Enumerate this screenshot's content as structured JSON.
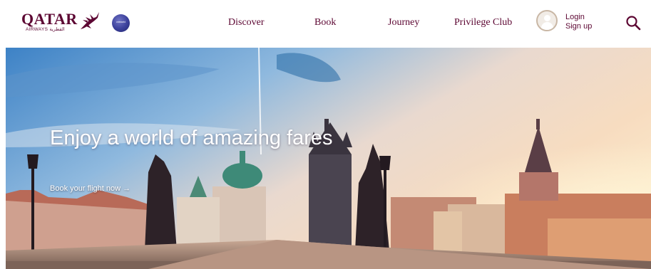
{
  "brand": {
    "name": "QATAR",
    "sub": "AIRWAYS القطرية",
    "alliance": "oneworld"
  },
  "nav": {
    "items": [
      {
        "label": "Discover"
      },
      {
        "label": "Book"
      },
      {
        "label": "Journey"
      },
      {
        "label": "Privilege Club"
      }
    ]
  },
  "account": {
    "login_label": "Login",
    "signup_label": "Sign up"
  },
  "hero": {
    "title": "Enjoy a world of amazing fares",
    "subtitle": "Book your flight now →"
  },
  "colors": {
    "brand": "#5c0632",
    "accent_gray": "#c9b7a5"
  },
  "icons": {
    "search": "search-icon",
    "user": "user-avatar-icon",
    "logo": "oryx-icon"
  }
}
